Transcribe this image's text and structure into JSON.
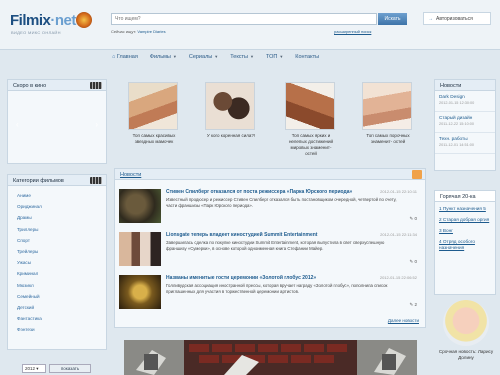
{
  "header": {
    "logo_main": "Filmix",
    "logo_suffix": "·net",
    "tagline": "ВИДЕО МИКС ОНЛАЙН",
    "search_placeholder": "Что ищем?",
    "search_button": "Искать",
    "search_hint_prefix": "Сейчас ищут:",
    "search_hint_value": "Vampire Diaries",
    "advanced_search": "расширенный поиск",
    "login": "Авторизоваться"
  },
  "nav": [
    {
      "label": "Главная",
      "caret": false
    },
    {
      "label": "Фильмы",
      "caret": true
    },
    {
      "label": "Сериалы",
      "caret": true
    },
    {
      "label": "Тексты",
      "caret": true
    },
    {
      "label": "ТОП",
      "caret": true
    },
    {
      "label": "Контакты",
      "caret": false
    }
  ],
  "soon": {
    "title": "Скоро в кино",
    "prev": "‹",
    "next": "›"
  },
  "categories": {
    "title": "Категории фильмов",
    "items": [
      "Аниме",
      "Ориджинал",
      "Драмы",
      "Триллеры",
      "Спорт",
      "Трейлеры",
      "Ужасы",
      "Криминал",
      "Мюзикл",
      "Семейный",
      "Детский",
      "Фантастика",
      "Фэнтези"
    ]
  },
  "year_filter": {
    "year": "2012",
    "button": "показать"
  },
  "featured": [
    {
      "caption": "Топ самых красивых звездных мамочек"
    },
    {
      "caption": "У кого коренная сила?!"
    },
    {
      "caption": "Топ самых ярких и нелепых достижений мировых знаменит- остей"
    },
    {
      "caption": "Топ самых порочных знаменит- остей"
    }
  ],
  "news": {
    "title": "Новости",
    "all_link": "Далее новости",
    "items": [
      {
        "title": "Стивен Спилберг отказался от поста режиссера «Парка Юрского периода»",
        "date": "2012-01-15 22:10:11",
        "text": "Известный продюсер и режиссер Стивен Спилберг отказался быть постановщиком очередной, четвертой по счету, части франшизы «Парк Юрского периода».",
        "comments": "0"
      },
      {
        "title": "Lionsgate теперь владеет киностудией Summit Entertainment",
        "date": "2012-01-15 22:11:34",
        "text": "Завершилась сделка по покупке киностудии Summit Entertainment, которая выпустила в свет сверхуспешную франшизу «Сумерки», в основе которой одноименная книга Стефании Майер.",
        "comments": "0"
      },
      {
        "title": "Названы именитые гости церемонии «Золотой глобус 2012»",
        "date": "2012-01-15 22:06:52",
        "text": "Голливудская ассоциация иностранной прессы, которая вручает награду «Золотой глобус», пополнила список приглашенных для участия в торжественной церемонии артистов.",
        "comments": "2"
      }
    ]
  },
  "right_news": {
    "title": "Новости",
    "items": [
      {
        "title": "Dark Design",
        "date": "2012-01-15 12:30:00"
      },
      {
        "title": "Старый дизайн",
        "date": "2011-12-22 15:10:00"
      },
      {
        "title": "Техн. работы",
        "date": "2011-12-01 14:51:00"
      }
    ]
  },
  "hot": {
    "title": "Горячая 20-ка",
    "items": [
      "1 Пункт назначения 5",
      "2 Старая добрая оргия",
      "3 Вонг",
      "4 Отряд особого назначения"
    ]
  },
  "promo": {
    "caption": "Срочная новость: Ларису Долину"
  }
}
